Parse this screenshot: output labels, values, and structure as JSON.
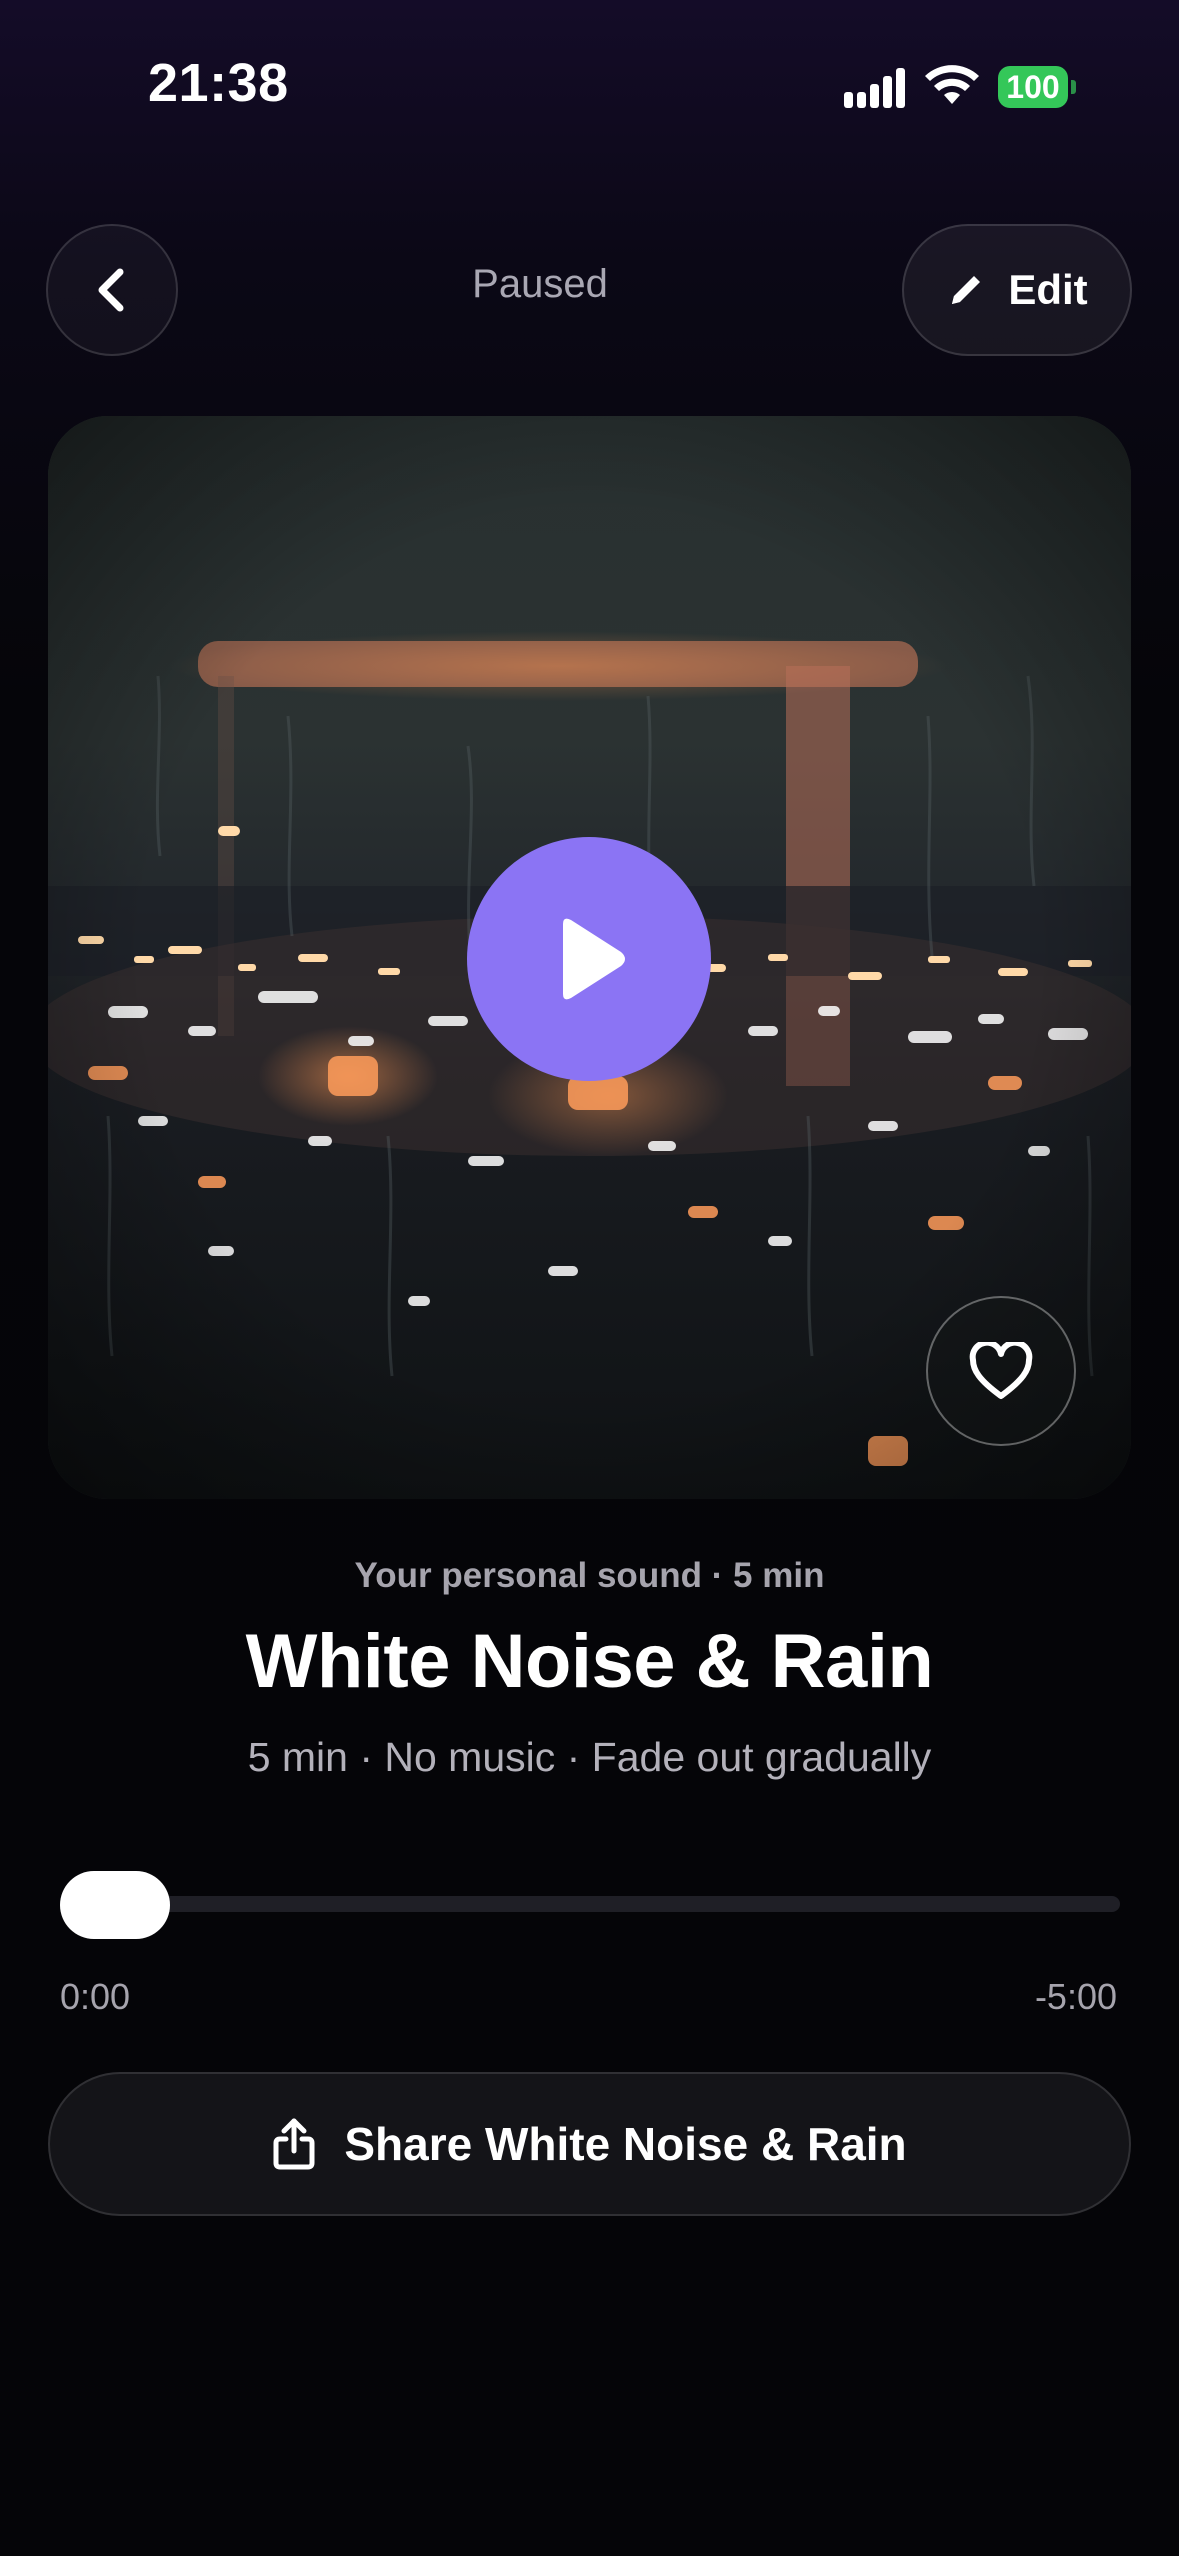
{
  "status_bar": {
    "time": "21:38",
    "battery": "100",
    "icons": [
      "signal-icon",
      "wifi-icon",
      "battery-icon"
    ]
  },
  "header": {
    "status": "Paused",
    "back_icon": "chevron-left-icon",
    "edit_label": "Edit",
    "edit_icon": "pencil-icon"
  },
  "player": {
    "play_icon": "play-icon",
    "like_icon": "heart-icon",
    "accent_color": "#8b74f4"
  },
  "track": {
    "subtitle": "Your personal sound · 5 min",
    "title": "White Noise & Rain",
    "details": "5 min · No music · Fade out gradually"
  },
  "progress": {
    "elapsed": "0:00",
    "remaining": "-5:00",
    "fraction": 0
  },
  "share": {
    "label": "Share White Noise & Rain",
    "icon": "share-icon"
  }
}
